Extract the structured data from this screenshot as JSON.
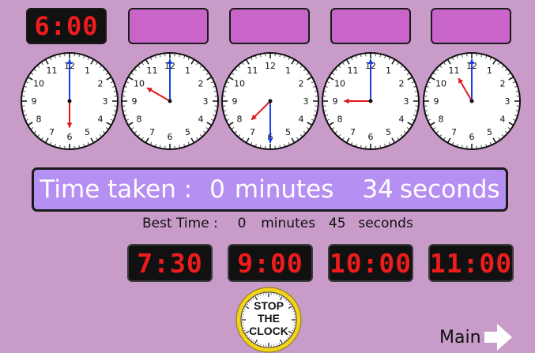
{
  "target_time": "6:00",
  "answer_slots": [
    "",
    "",
    "",
    ""
  ],
  "clocks": [
    {
      "name": "clock-6-00",
      "hour": 6,
      "minute": 0
    },
    {
      "name": "clock-10-00",
      "hour": 10,
      "minute": 0
    },
    {
      "name": "clock-7-30",
      "hour": 7,
      "minute": 30
    },
    {
      "name": "clock-9-00",
      "hour": 9,
      "minute": 0
    },
    {
      "name": "clock-11-00",
      "hour": 11,
      "minute": 0
    }
  ],
  "timer": {
    "label": "Time taken :",
    "minutes": "0",
    "minutes_unit": "minutes",
    "seconds": "34",
    "seconds_unit": "seconds"
  },
  "best_time": {
    "label": "Best Time :",
    "minutes": "0",
    "minutes_unit": "minutes",
    "seconds": "45",
    "seconds_unit": "seconds"
  },
  "answers": [
    "7:30",
    "9:00",
    "10:00",
    "11:00"
  ],
  "stop_button": {
    "line1": "STOP",
    "line2": "THE",
    "line3": "CLOCK"
  },
  "main_button": {
    "label": "Main",
    "icon": "arrow-right-icon"
  },
  "colors": {
    "background": "#c99bc9",
    "empty_slot": "#c964c9",
    "banner": "#b68ff2",
    "digital_red": "#ee1c1c",
    "minute_hand": "#1a3fe0",
    "hour_hand": "#e01a1a"
  }
}
